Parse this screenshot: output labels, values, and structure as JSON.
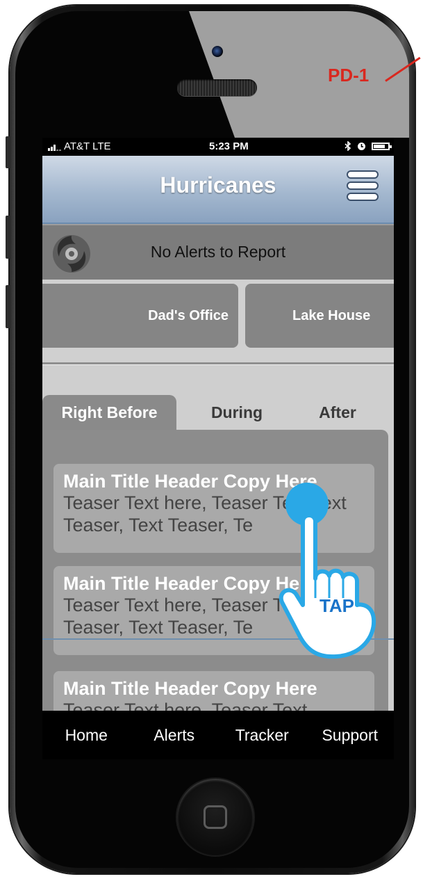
{
  "annotation": {
    "label": "PD-1",
    "color": "#d9281f"
  },
  "status_bar": {
    "carrier": "AT&T LTE",
    "time": "5:23 PM",
    "icons": [
      "bluetooth-icon",
      "alarm-icon",
      "battery-icon"
    ]
  },
  "header": {
    "title": "Hurricanes",
    "menu_icon": "hamburger-menu-icon"
  },
  "alert": {
    "text": "No Alerts to Report",
    "icon": "hurricane-logo-icon"
  },
  "locations": [
    "Dad's Office",
    "Lake House"
  ],
  "tabs": [
    {
      "label": "Right Before",
      "active": true
    },
    {
      "label": "During",
      "active": false
    },
    {
      "label": "After",
      "active": false
    }
  ],
  "cards": [
    {
      "title": "Main Title Header Copy Here",
      "teaser": "Teaser Text here, Teaser Text Text Teaser, Text Teaser, Te"
    },
    {
      "title": "Main Title Header Copy Here",
      "teaser": "Teaser Text here, Teaser Text Text Teaser, Text Teaser, Te"
    },
    {
      "title": "Main Title Header Copy Here",
      "teaser": "Teaser Text here, Teaser Text"
    }
  ],
  "tabbar": [
    "Home",
    "Alerts",
    "Tracker",
    "Support"
  ],
  "gesture": {
    "label": "TAP",
    "color": "#2aa8e6"
  }
}
